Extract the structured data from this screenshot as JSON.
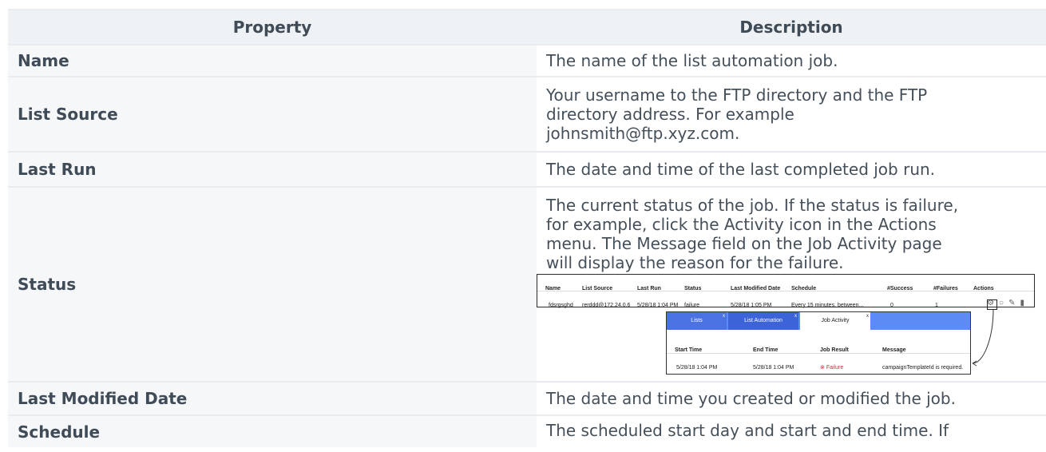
{
  "table": {
    "headers": [
      "Property",
      "Description"
    ],
    "rows": [
      {
        "property": "Name",
        "description": [
          "The name of the list automation job."
        ]
      },
      {
        "property": "List Source",
        "description": [
          "Your username to the FTP directory and the FTP",
          "directory address. For example",
          "johnsmith@ftp.xyz.com."
        ]
      },
      {
        "property": "Last Run",
        "description": [
          "The date and time of the last completed job run."
        ]
      },
      {
        "property": "Status",
        "description": [
          "The current status of the job. If the status is failure,",
          "for example, click the Activity icon in the Actions",
          "menu. The Message field on the Job Activity page",
          "will display the reason for the failure."
        ]
      },
      {
        "property": "Last Modified Date",
        "description": [
          "The date and time you created or modified the job."
        ]
      },
      {
        "property": "Schedule",
        "description": [
          "The scheduled start day and start and end time. If"
        ]
      }
    ]
  },
  "screenshot": {
    "jobs_headers": [
      "Name",
      "List Source",
      "Last Run",
      "Status",
      "Last Modified Date",
      "Schedule",
      "#Success",
      "#Failures",
      "Actions"
    ],
    "jobs_row": [
      "fdsrgsghd",
      "rerddd@172.24.0.6",
      "5/28/18 1:04 PM",
      "failure",
      "5/28/18 1:05 PM",
      "Every 15 minutes, between...",
      "0",
      "1"
    ],
    "action_icons": [
      "activity-icon",
      "settings-icon",
      "edit-icon",
      "delete-icon"
    ],
    "tabs": [
      "Lists",
      "List Automation",
      "Job Activity"
    ],
    "activity_headers": [
      "Start Time",
      "End Time",
      "Job Result",
      "Message"
    ],
    "activity_row": [
      "5/28/18 1:04 PM",
      "5/28/18 1:04 PM",
      "Failure",
      "campaignTemplateId is required."
    ]
  }
}
